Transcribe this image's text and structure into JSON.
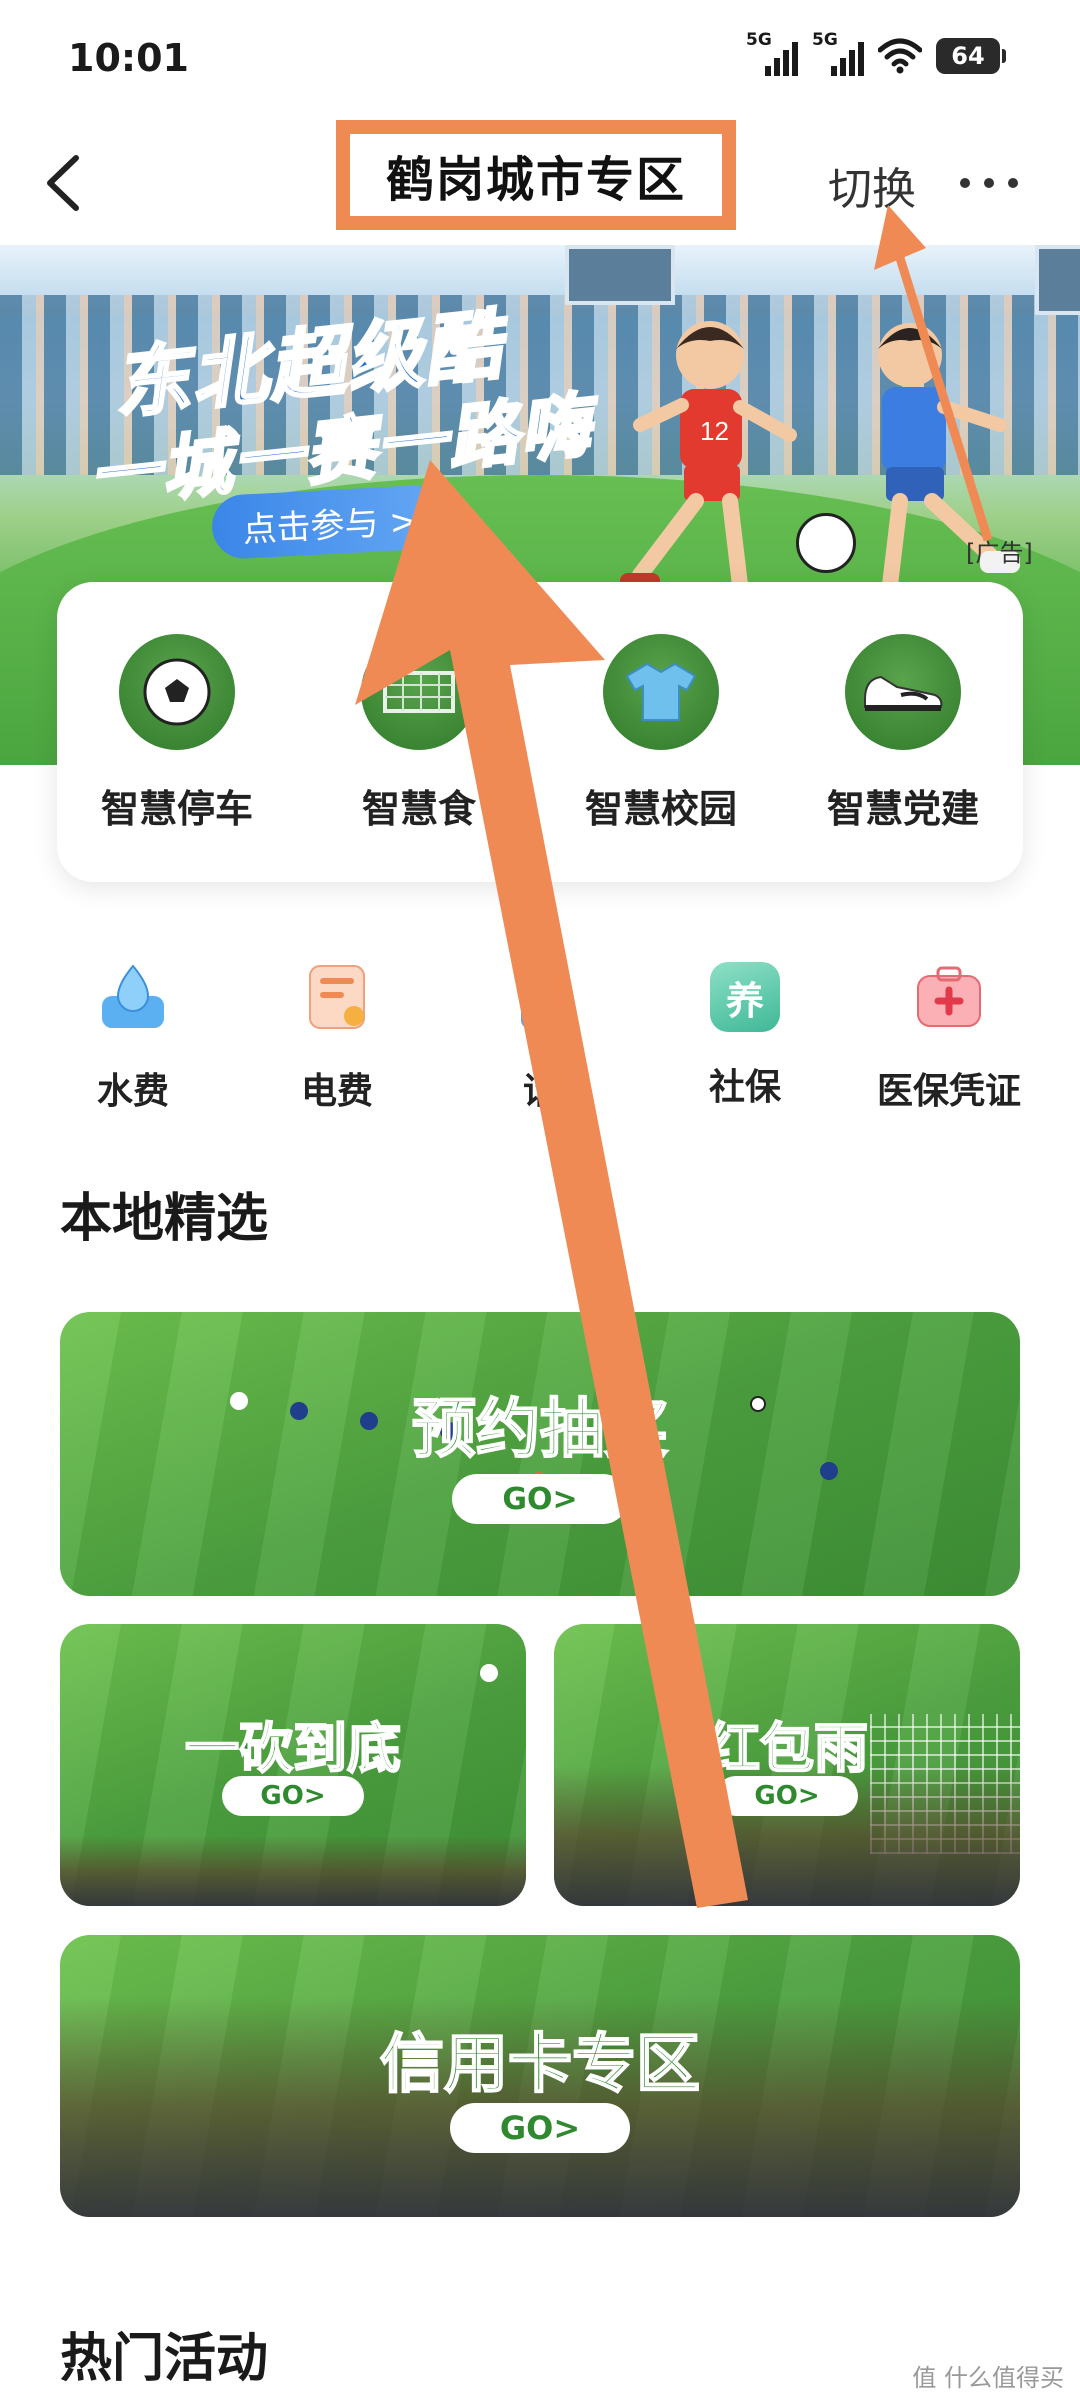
{
  "status_bar": {
    "time": "10:01",
    "signal1": "5G",
    "signal2": "5G",
    "battery": "64"
  },
  "header": {
    "back_icon": "chevron-left-icon",
    "title": "鹤岗城市专区",
    "switch_label": "切换",
    "more_icon": "more-dots-icon"
  },
  "banner": {
    "title_line1": "东北超级酷",
    "title_line2": "一城一赛一路嗨",
    "button": "点击参与 >",
    "ad_tag": "[广告]"
  },
  "services": [
    {
      "label": "智慧停车",
      "icon": "soccer-ball-icon"
    },
    {
      "label": "智慧食",
      "icon": "goal-net-icon"
    },
    {
      "label": "智慧校园",
      "icon": "jersey-icon"
    },
    {
      "label": "智慧党建",
      "icon": "sneaker-icon"
    }
  ],
  "utilities": [
    {
      "label": "水费",
      "icon": "water-drop-icon"
    },
    {
      "label": "电费",
      "icon": "electric-bill-icon"
    },
    {
      "label": "话",
      "icon": "phone-bill-icon"
    },
    {
      "label": "社保",
      "icon": "pension-icon",
      "icon_char": "养"
    },
    {
      "label": "医保凭证",
      "icon": "medical-kit-icon"
    }
  ],
  "sections": {
    "local_picks": "本地精选",
    "hot_events": "热门活动"
  },
  "tiles": [
    {
      "title": "预约抽奖",
      "go": "GO>"
    },
    {
      "title": "一砍到底",
      "go": "GO>"
    },
    {
      "title": "红包雨",
      "go": "GO>"
    },
    {
      "title": "信用卡专区",
      "go": "GO>"
    }
  ],
  "watermark": "值 什么值得买",
  "colors": {
    "annotation_arrow": "#f08a55",
    "brand_green": "#2f8a2f",
    "banner_blue": "#1e6fd8"
  }
}
